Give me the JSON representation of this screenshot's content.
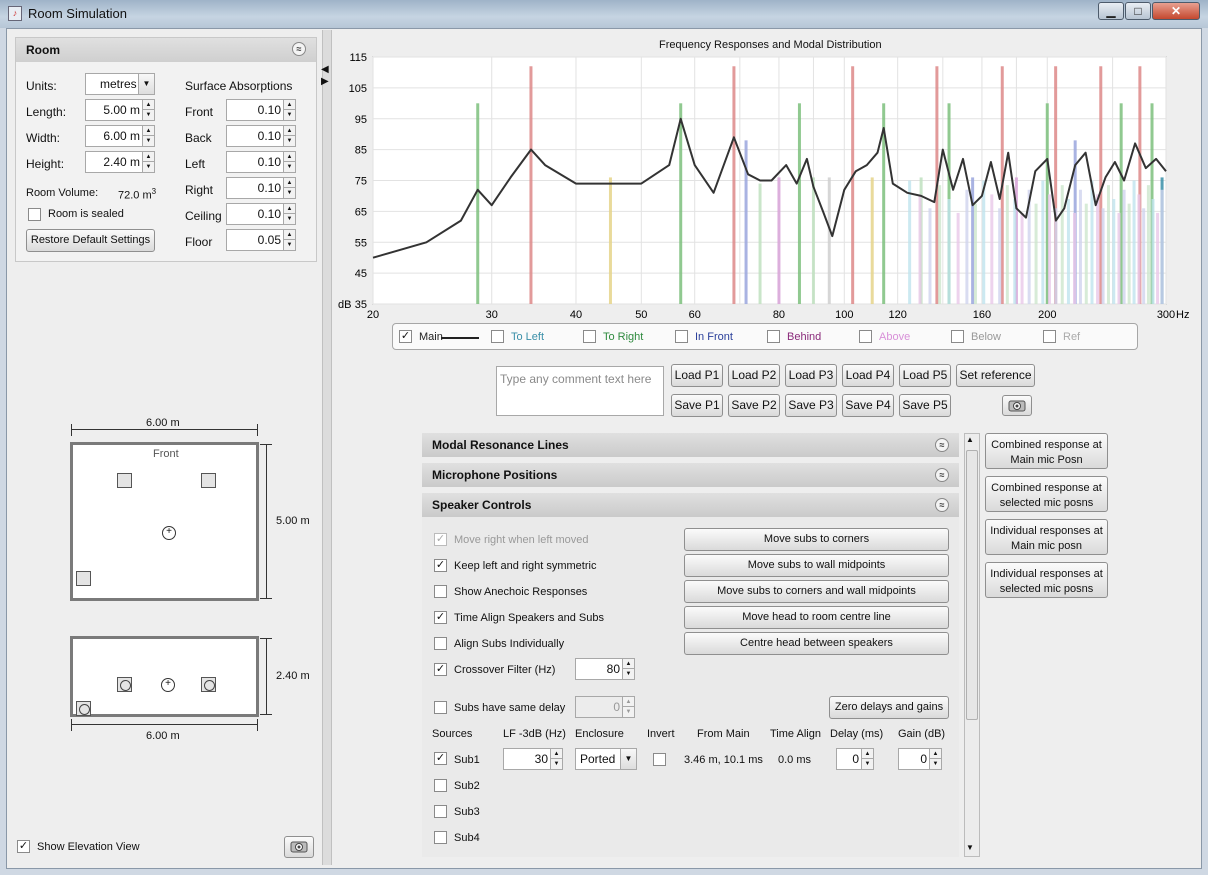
{
  "window": {
    "title": "Room Simulation",
    "app_icon_glyph": "♪",
    "min_glyph": "▁",
    "max_glyph": "□",
    "close_glyph": "✕"
  },
  "room_panel": {
    "header": "Room",
    "collapse_icon": "≈",
    "units_label": "Units:",
    "units_value": "metres",
    "length_label": "Length:",
    "length_value": "5.00 m",
    "width_label": "Width:",
    "width_value": "6.00 m",
    "height_label": "Height:",
    "height_value": "2.40 m",
    "volume_label": "Room Volume:",
    "volume_value": "72.0 m",
    "volume_unit_sup": "3",
    "sealed_label": "Room is sealed",
    "sealed_checked": false,
    "restore_button": "Restore Default Settings",
    "absorptions_title": "Surface Absorptions",
    "absorptions": [
      {
        "label": "Front",
        "value": "0.10"
      },
      {
        "label": "Back",
        "value": "0.10"
      },
      {
        "label": "Left",
        "value": "0.10"
      },
      {
        "label": "Right",
        "value": "0.10"
      },
      {
        "label": "Ceiling",
        "value": "0.10"
      },
      {
        "label": "Floor",
        "value": "0.05"
      }
    ]
  },
  "plan_view": {
    "width_label": "6.00 m",
    "depth_label": "5.00 m",
    "front_label": "Front"
  },
  "elevation_view": {
    "height_label": "2.40 m",
    "width_label": "6.00 m"
  },
  "show_elevation": {
    "label": "Show Elevation View",
    "checked": true
  },
  "chart": {
    "title": "Frequency Responses and Modal Distribution",
    "y_unit": "dB",
    "x_unit": "Hz",
    "y_ticks": [
      "35",
      "45",
      "55",
      "65",
      "75",
      "85",
      "95",
      "105",
      "115"
    ],
    "x_ticks": [
      "20",
      "30",
      "40",
      "50",
      "60",
      "80",
      "100",
      "120",
      "160",
      "200",
      "300"
    ],
    "legend": [
      {
        "label": "Main",
        "checked": true,
        "color": "#222222"
      },
      {
        "label": "To Left",
        "checked": false,
        "color": "#3a8fa8"
      },
      {
        "label": "To Right",
        "checked": false,
        "color": "#2e8a3e"
      },
      {
        "label": "In Front",
        "checked": false,
        "color": "#2a3f9a"
      },
      {
        "label": "Behind",
        "checked": false,
        "color": "#8a2a7a"
      },
      {
        "label": "Above",
        "checked": false,
        "color": "#d890d8"
      },
      {
        "label": "Below",
        "checked": false,
        "color": "#999999"
      },
      {
        "label": "Ref",
        "checked": false,
        "color": "#aaaaaa"
      }
    ]
  },
  "chart_data": {
    "type": "line",
    "title": "Frequency Responses and Modal Distribution",
    "xlabel": "Hz",
    "ylabel": "dB",
    "xscale": "log",
    "xlim": [
      20,
      300
    ],
    "ylim": [
      35,
      115
    ],
    "grid": true,
    "series": [
      {
        "name": "Main",
        "x": [
          20,
          24,
          27,
          28.6,
          30,
          32,
          34.3,
          36,
          40,
          45,
          50,
          55,
          57.2,
          60,
          64,
          68.6,
          72,
          75,
          78,
          82,
          85,
          88,
          90,
          93,
          96,
          100,
          104,
          108,
          112,
          114.4,
          118,
          124,
          130,
          136,
          140,
          145,
          150,
          155,
          160,
          165,
          170,
          175,
          180,
          186,
          192,
          200,
          206,
          212,
          220,
          228,
          236,
          244,
          252,
          260,
          270,
          280,
          290,
          300
        ],
        "y": [
          50,
          55,
          62,
          72,
          67,
          76,
          85,
          80,
          74,
          74,
          74,
          80,
          95,
          80,
          71,
          89,
          77,
          75,
          75,
          80,
          74,
          82,
          73,
          65,
          57,
          72,
          78,
          80,
          84,
          92,
          74,
          71,
          70,
          68,
          85,
          72,
          82,
          67,
          70,
          81,
          69,
          84,
          66,
          63,
          78,
          82,
          62,
          66,
          80,
          84,
          67,
          76,
          81,
          75,
          87,
          79,
          82,
          78
        ]
      }
    ],
    "modal_lines": [
      {
        "freq": 28.6,
        "level": 100,
        "color": "#7cbf7c"
      },
      {
        "freq": 34.3,
        "level": 112,
        "color": "#d88"
      },
      {
        "freq": 45,
        "level": 76,
        "color": "#e5d38a"
      },
      {
        "freq": 57.2,
        "level": 100,
        "color": "#7cbf7c"
      },
      {
        "freq": 68.6,
        "level": 112,
        "color": "#d88"
      },
      {
        "freq": 71.5,
        "level": 88,
        "color": "#9aa6dd"
      },
      {
        "freq": 75,
        "level": 74,
        "color": "#bfe0bf"
      },
      {
        "freq": 80,
        "level": 76,
        "color": "#d8a3d8"
      },
      {
        "freq": 85.8,
        "level": 100,
        "color": "#7cbf7c"
      },
      {
        "freq": 90,
        "level": 76,
        "color": "#bfe0bf"
      },
      {
        "freq": 95,
        "level": 76,
        "color": "#cfcfcf"
      },
      {
        "freq": 102.9,
        "level": 112,
        "color": "#d88"
      },
      {
        "freq": 110,
        "level": 76,
        "color": "#e5d38a"
      },
      {
        "freq": 114.4,
        "level": 100,
        "color": "#7cbf7c"
      },
      {
        "freq": 130,
        "level": 76,
        "color": "#bfe0bf"
      },
      {
        "freq": 137.2,
        "level": 112,
        "color": "#d88"
      },
      {
        "freq": 143,
        "level": 100,
        "color": "#7cbf7c"
      },
      {
        "freq": 155,
        "level": 76,
        "color": "#9aa6dd"
      },
      {
        "freq": 171.5,
        "level": 112,
        "color": "#d88"
      },
      {
        "freq": 180,
        "level": 76,
        "color": "#d8a3d8"
      },
      {
        "freq": 200,
        "level": 100,
        "color": "#7cbf7c"
      },
      {
        "freq": 205.8,
        "level": 112,
        "color": "#d88"
      },
      {
        "freq": 220,
        "level": 88,
        "color": "#9aa6dd"
      },
      {
        "freq": 240.1,
        "level": 112,
        "color": "#d88"
      },
      {
        "freq": 257.4,
        "level": 100,
        "color": "#7cbf7c"
      },
      {
        "freq": 274.4,
        "level": 112,
        "color": "#d88"
      },
      {
        "freq": 286,
        "level": 100,
        "color": "#7cbf7c"
      },
      {
        "freq": 296,
        "level": 76,
        "color": "#3a8fa8"
      }
    ]
  },
  "comment": {
    "placeholder": "Type any comment text here"
  },
  "load_buttons": [
    "Load P1",
    "Load P2",
    "Load P3",
    "Load P4",
    "Load P5"
  ],
  "save_buttons": [
    "Save P1",
    "Save P2",
    "Save P3",
    "Save P4",
    "Save P5"
  ],
  "set_reference": "Set reference",
  "sections": {
    "modal": "Modal Resonance Lines",
    "mic": "Microphone Positions",
    "speaker": "Speaker Controls",
    "expand_icon": "≈",
    "collapse_icon": "≈"
  },
  "speaker_controls": {
    "options": [
      {
        "label": "Move right when left moved",
        "checked": true,
        "disabled": true
      },
      {
        "label": "Keep left and right symmetric",
        "checked": true,
        "disabled": false
      },
      {
        "label": "Show Anechoic Responses",
        "checked": false,
        "disabled": false
      },
      {
        "label": "Time Align Speakers and Subs",
        "checked": true,
        "disabled": false
      },
      {
        "label": "Align Subs Individually",
        "checked": false,
        "disabled": false
      },
      {
        "label": "Crossover Filter (Hz)",
        "checked": true,
        "disabled": false
      }
    ],
    "crossover_value": "80",
    "same_delay_label": "Subs have same delay",
    "same_delay_value": "0",
    "move_buttons": [
      "Move subs to corners",
      "Move subs to wall midpoints",
      "Move subs to corners and wall midpoints",
      "Move head to room centre line",
      "Centre head between speakers"
    ],
    "zero_button": "Zero delays and gains",
    "table_headers": {
      "sources": "Sources",
      "lf": "LF -3dB (Hz)",
      "enclosure": "Enclosure",
      "invert": "Invert",
      "from_main": "From Main",
      "time_align": "Time Align",
      "delay": "Delay (ms)",
      "gain": "Gain (dB)"
    },
    "sub1": {
      "label": "Sub1",
      "checked": true,
      "lf": "30",
      "enclosure": "Ported",
      "invert": false,
      "from_main": "3.46 m, 10.1 ms",
      "time_align": "0.0 ms",
      "delay": "0",
      "gain": "0"
    },
    "sub_others": [
      "Sub2",
      "Sub3",
      "Sub4"
    ]
  },
  "side_buttons": [
    {
      "line1": "Combined response at",
      "line2": "Main mic Posn"
    },
    {
      "line1": "Combined response at",
      "line2": "selected mic posns"
    },
    {
      "line1": "Individual responses at",
      "line2": "Main mic posn"
    },
    {
      "line1": "Individual responses at",
      "line2": "selected mic posns"
    }
  ],
  "icons": {
    "camera": "camera-icon",
    "check": "✓",
    "spin_up": "▲",
    "spin_down": "▼",
    "combo_arrow": "▼",
    "split_left": "◀",
    "split_right": "▶"
  }
}
